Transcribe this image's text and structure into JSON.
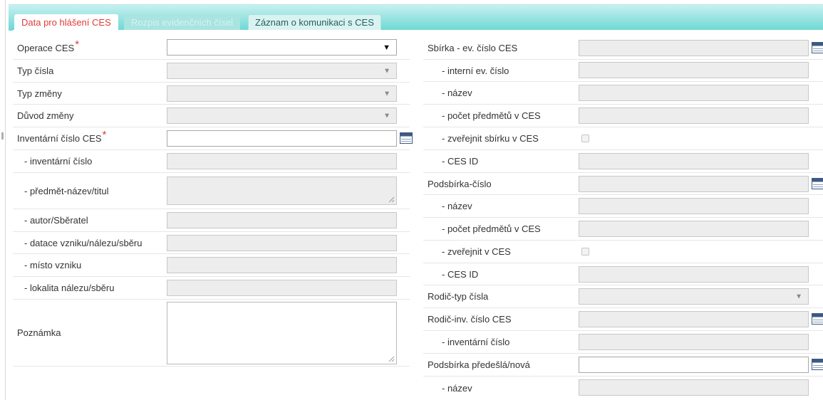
{
  "tabs": [
    {
      "label": "Data pro hlášení CES",
      "state": "active"
    },
    {
      "label": "Rozpis evidenčních čísel",
      "state": "disabled"
    },
    {
      "label": "Záznam o komunikaci s CES",
      "state": "normal"
    }
  ],
  "left": {
    "operace_ces": {
      "label": "Operace CES",
      "required": "*"
    },
    "typ_cisla": {
      "label": "Typ čísla"
    },
    "typ_zmeny": {
      "label": "Typ změny"
    },
    "duvod_zmeny": {
      "label": "Důvod změny"
    },
    "inventarni_cislo_ces": {
      "label": "Inventární číslo CES",
      "required": "*"
    },
    "inventarni_cislo": {
      "label": "- inventární číslo"
    },
    "predmet_nazev": {
      "label": "- předmět-název/titul"
    },
    "autor": {
      "label": "- autor/Sběratel"
    },
    "datace": {
      "label": "- datace vzniku/nálezu/sběru"
    },
    "misto_vzniku": {
      "label": "- místo vzniku"
    },
    "lokalita": {
      "label": "- lokalita nálezu/sběru"
    },
    "poznamka": {
      "label": "Poznámka"
    }
  },
  "right": {
    "sbirka_ev_cislo": {
      "label": "Sbírka - ev. číslo CES"
    },
    "sbirka_interni": {
      "label": "- interní ev. číslo"
    },
    "sbirka_nazev": {
      "label": "- název"
    },
    "sbirka_pocet": {
      "label": "- počet předmětů v CES"
    },
    "sbirka_zverejnit": {
      "label": "- zveřejnit sbírku v CES"
    },
    "sbirka_ces_id": {
      "label": "- CES ID"
    },
    "podsbirka_cislo": {
      "label": "Podsbírka-číslo"
    },
    "podsbirka_nazev": {
      "label": "- název"
    },
    "podsbirka_pocet": {
      "label": "- počet předmětů v CES"
    },
    "podsbirka_zverejnit": {
      "label": "- zveřejnit v CES"
    },
    "podsbirka_ces_id": {
      "label": "- CES ID"
    },
    "rodic_typ": {
      "label": "Rodič-typ čísla"
    },
    "rodic_inv": {
      "label": "Rodič-inv. číslo CES"
    },
    "rodic_inventarni": {
      "label": "- inventární číslo"
    },
    "podsbirka_predesla": {
      "label": "Podsbírka předešlá/nová"
    },
    "podsbirka_predesla_nazev": {
      "label": "- název"
    }
  },
  "icons": {
    "select_arrow": "▼",
    "calendar": "calendar-picker-icon"
  },
  "colors": {
    "accent_red": "#e03b3b",
    "tab_bar": "#6cd8d3",
    "disabled_field": "#ededed"
  }
}
